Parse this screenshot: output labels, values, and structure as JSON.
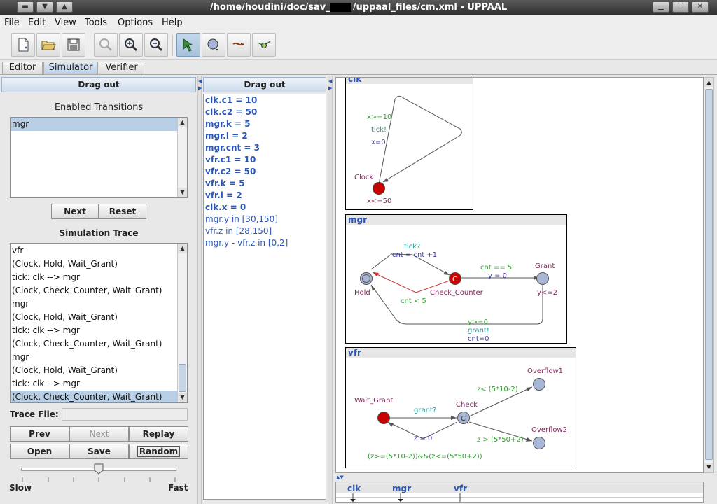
{
  "window": {
    "title_left": "/home/houdini/doc/sav_",
    "title_right": "/uppaal_files/cm.xml - UPPAAL"
  },
  "menu": [
    "File",
    "Edit",
    "View",
    "Tools",
    "Options",
    "Help"
  ],
  "toolbar_icons": [
    "new-document-icon",
    "open-folder-icon",
    "save-icon",
    "zoom-fit-icon",
    "zoom-in-icon",
    "zoom-out-icon",
    "select-arrow-icon",
    "add-location-icon",
    "add-edge-icon",
    "add-nail-icon"
  ],
  "tabs": [
    "Editor",
    "Simulator",
    "Verifier"
  ],
  "left_panel": {
    "drag_out": "Drag out",
    "enabled_label": "Enabled Transitions",
    "enabled": [
      "mgr"
    ],
    "next": "Next",
    "reset": "Reset",
    "trace_label": "Simulation Trace",
    "trace": [
      "vfr",
      "(Clock, Hold, Wait_Grant)",
      "tick: clk --> mgr",
      "(Clock, Check_Counter, Wait_Grant)",
      "mgr",
      "(Clock, Hold, Wait_Grant)",
      "tick: clk --> mgr",
      "(Clock, Check_Counter, Wait_Grant)",
      "mgr",
      "(Clock, Hold, Wait_Grant)",
      "tick: clk --> mgr",
      "(Clock, Check_Counter, Wait_Grant)"
    ],
    "trace_file_label": "Trace File:",
    "trace_file_value": "",
    "prev": "Prev",
    "next2": "Next",
    "replay": "Replay",
    "open": "Open",
    "save": "Save",
    "random": "Random",
    "slow": "Slow",
    "fast": "Fast",
    "speed_level": 0.5
  },
  "vars_panel": {
    "drag_out": "Drag out",
    "vars": [
      "clk.c1 = 10",
      "clk.c2 = 50",
      "mgr.k = 5",
      "mgr.l = 2",
      "mgr.cnt = 3",
      "vfr.c1 = 10",
      "vfr.c2 = 50",
      "vfr.k = 5",
      "vfr.l = 2",
      "clk.x = 0"
    ],
    "clocks": [
      "mgr.y in [30,150]",
      "vfr.z in [28,150]",
      "mgr.y - vfr.z in [0,2]"
    ]
  },
  "processes": {
    "clk": {
      "name": "clk",
      "location": "Clock",
      "invariant": "x<=50",
      "guard": "x>=10",
      "sync": "tick!",
      "assign": "x=0"
    },
    "mgr": {
      "name": "mgr",
      "hold": "Hold",
      "check": "Check_Counter",
      "grant": "Grant",
      "grant_inv": "y<=2",
      "tick_sync": "tick?",
      "tick_assign": "cnt = cnt +1",
      "lt_guard": "cnt < 5",
      "eq_guard": "cnt == 5",
      "eq_assign": "y = 0",
      "back_guard": "y>=0",
      "back_sync": "grant!",
      "back_assign": "cnt=0"
    },
    "vfr": {
      "name": "vfr",
      "wait": "Wait_Grant",
      "check": "Check",
      "ov1": "Overflow1",
      "ov2": "Overflow2",
      "grant_sync": "grant?",
      "z_assign": "z = 0",
      "g1": "z< (5*10-2)",
      "g2": "z > (5*50+2)",
      "g3": "(z>=(5*10-2))&&(z<=(5*50+2))"
    }
  },
  "msc_tabs": [
    "clk",
    "mgr",
    "vfr"
  ],
  "colors": {
    "urgent_red": "#c80000",
    "committed_blue": "#a9b7d6",
    "guard_green": "#3a9a3a",
    "sync_teal": "#2a8c8c",
    "assign_blue": "#3a3aa0",
    "name_purple": "#7a2a5a"
  }
}
